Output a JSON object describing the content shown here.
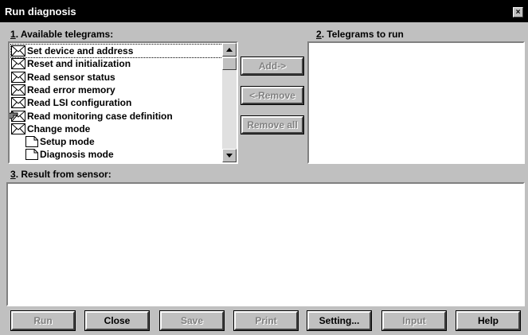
{
  "window": {
    "title": "Run diagnosis",
    "close_glyph": "×"
  },
  "available": {
    "mnemonic": "1",
    "label": ". Available telegrams:",
    "items": [
      {
        "icon": "envelope-icon",
        "text": "Set device and address",
        "selected": true
      },
      {
        "icon": "envelope-icon",
        "text": "Reset and initialization"
      },
      {
        "icon": "envelope-icon",
        "text": "Read sensor status"
      },
      {
        "icon": "envelope-icon",
        "text": "Read error memory"
      },
      {
        "icon": "envelope-icon",
        "text": "Read LSI configuration"
      },
      {
        "icon": "hand-envelope-icon",
        "text": "Read monitoring case definition"
      },
      {
        "icon": "envelope-icon",
        "text": "Change mode"
      },
      {
        "icon": "document-icon",
        "text": "Setup mode"
      },
      {
        "icon": "document-icon",
        "text": "Diagnosis mode"
      }
    ]
  },
  "torun": {
    "mnemonic": "2",
    "label": ". Telegrams to run"
  },
  "result": {
    "mnemonic": "3",
    "label": ". Result from sensor:"
  },
  "middle_buttons": {
    "add": {
      "label": "Add->",
      "disabled": true
    },
    "remove": {
      "label": "<-Remove",
      "disabled": true
    },
    "remove_all": {
      "label": "Remove all",
      "disabled": true
    }
  },
  "bottom_buttons": {
    "run": {
      "label": "Run",
      "disabled": true
    },
    "close": {
      "label": "Close",
      "disabled": false
    },
    "save": {
      "label": "Save",
      "disabled": true
    },
    "print": {
      "label": "Print",
      "disabled": true
    },
    "setting": {
      "label": "Setting...",
      "disabled": false
    },
    "input": {
      "label": "Input",
      "disabled": true
    },
    "help": {
      "label": "Help",
      "disabled": false
    }
  }
}
